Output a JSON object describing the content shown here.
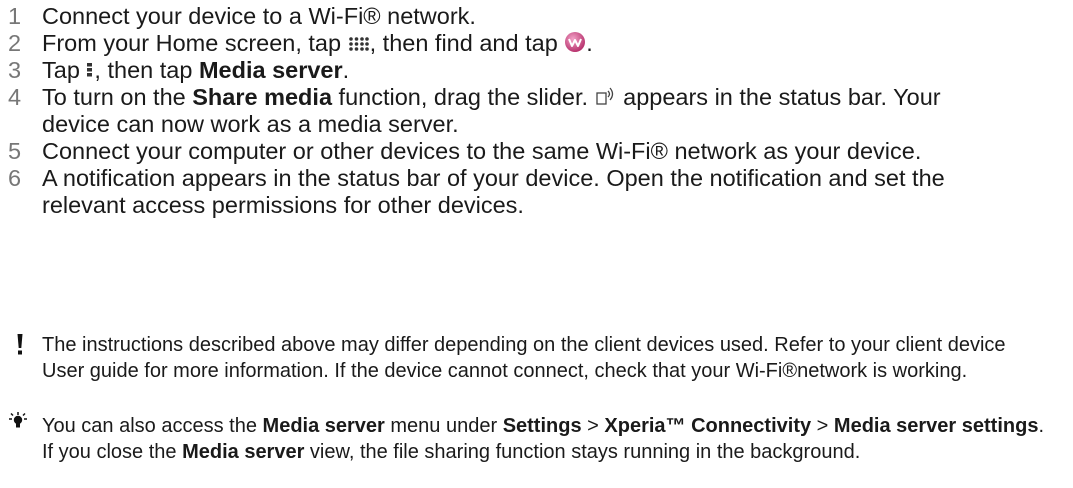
{
  "steps": [
    {
      "num": "1",
      "text": "Connect your device to a Wi-Fi® network."
    },
    {
      "num": "2",
      "a": "From your Home screen, tap ",
      "b": ", then find and tap ",
      "c": ".",
      "icon1": "app-grid-icon",
      "icon2": "media-player-icon"
    },
    {
      "num": "3",
      "a": "Tap ",
      "b": ", then tap ",
      "bold": "Media server",
      "c": ".",
      "icon1": "menu-dots-icon"
    },
    {
      "num": "4",
      "a": "To turn on the ",
      "bold": "Share media",
      "b": " function, drag the slider. ",
      "c": " appears in the status bar. Your device can now work as a media server.",
      "icon1": "share-media-status-icon"
    },
    {
      "num": "5",
      "text": "Connect your computer or other devices to the same Wi-Fi® network as your device."
    },
    {
      "num": "6",
      "text": "A notification appears in the status bar of your device. Open the notification and set the relevant access permissions for other devices."
    }
  ],
  "warning": {
    "icon": "exclamation-icon",
    "text": "The instructions described above may differ depending on the client devices used. Refer to your client device User guide for more information. If the device cannot connect, check that your Wi-Fi®network is working."
  },
  "tip": {
    "icon": "lightbulb-icon",
    "t1": "You can also access the ",
    "b1": "Media server",
    "t2": " menu under ",
    "b2": "Settings",
    "t3": " > ",
    "b3": "Xperia™ Connectivity",
    "t4": " > ",
    "b4": "Media server settings",
    "t5": ". If you close the ",
    "b5": "Media server",
    "t6": " view, the file sharing function stays running in the background."
  },
  "colors": {
    "icon_pink": "#d94a8c",
    "text": "#1a1a1a",
    "number": "#777777"
  }
}
